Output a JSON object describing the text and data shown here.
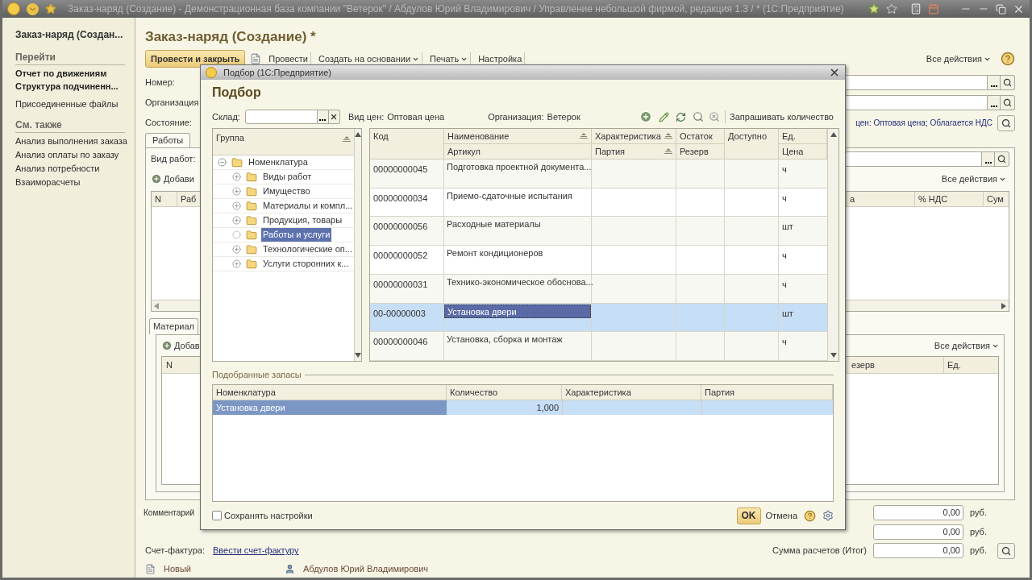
{
  "window": {
    "title": "Заказ-наряд (Создание) - Демонстрационная база компании \"Ветерок\" / Абдулов Юрий Владимирович / Управление небольшой фирмой, редакция 1.3 / * (1С:Предприятие)"
  },
  "sidebar": {
    "items": [
      {
        "kind": "title",
        "label": "Заказ-наряд (Создан..."
      },
      {
        "kind": "header",
        "label": "Перейти"
      },
      {
        "kind": "bold",
        "label": "Отчет по движениям"
      },
      {
        "kind": "bold",
        "label": "Структура подчиненн..."
      },
      {
        "kind": "link",
        "label": "Присоединенные файлы"
      },
      {
        "kind": "header",
        "label": "См. также"
      },
      {
        "kind": "link",
        "label": "Анализ выполнения заказа"
      },
      {
        "kind": "link",
        "label": "Анализ оплаты по заказу"
      },
      {
        "kind": "link",
        "label": "Анализ потребности"
      },
      {
        "kind": "link",
        "label": "Взаиморасчеты"
      }
    ]
  },
  "form": {
    "title": "Заказ-наряд (Создание) *",
    "toolbar": {
      "primary": "Провести и закрыть",
      "buttons": [
        {
          "label": "Провести",
          "dropdown": false
        },
        {
          "label": "Создать на основании",
          "dropdown": true
        },
        {
          "label": "Печать",
          "dropdown": true
        },
        {
          "label": "Настройка",
          "dropdown": false
        }
      ],
      "all_actions": "Все действия"
    },
    "fields": [
      {
        "label": "Номер:"
      },
      {
        "label": "Организация"
      },
      {
        "label": "Состояние:",
        "link": "цен: Оптовая цена; Облагается НДС"
      }
    ],
    "tabs": [
      {
        "label": "Работы",
        "selected": true
      }
    ],
    "works": {
      "label": "Вид работ:",
      "add": "Добави",
      "all_actions": "Все действия",
      "left_columns": [
        "N",
        "Раб"
      ],
      "right_columns": [
        "а",
        "% НДС",
        "Сум"
      ]
    },
    "materials": {
      "tabs": [
        {
          "label": "Материал",
          "selected": true
        }
      ],
      "add": "Добав",
      "all_actions": "Все действия",
      "left_columns": [
        "N"
      ],
      "right_columns": [
        "езерв",
        "Ед."
      ]
    },
    "comment_label": "Комментарий",
    "totals": [
      {
        "value": "0,00",
        "unit": "руб."
      },
      {
        "value": "0,00",
        "unit": "руб."
      },
      {
        "label": "Сумма расчетов (Итог)",
        "value": "0,00",
        "unit": "руб."
      }
    ],
    "invoice": {
      "label": "Счет-фактура:",
      "link": "Ввести счет-фактуру"
    },
    "status": {
      "state": "Новый",
      "user": "Абдулов Юрий Владимирович"
    }
  },
  "dialog": {
    "title": "Подбор (1С:Предприятие)",
    "heading": "Подбор",
    "warehouse_label": "Склад:",
    "price_label": "Вид цен:",
    "price_value": "Оптовая цена",
    "org_label": "Организация:",
    "org_value": "Ветерок",
    "ask_quantity": "Запрашивать количество",
    "tree": {
      "header": "Группа",
      "root": {
        "label": "Номенклатура",
        "expanded": true,
        "selected": false,
        "children": [
          {
            "label": "Виды работ",
            "kind": "group",
            "selected": false
          },
          {
            "label": "Имущество",
            "kind": "group",
            "selected": false
          },
          {
            "label": "Материалы и компл...",
            "kind": "group",
            "selected": false
          },
          {
            "label": "Продукция, товары",
            "kind": "group",
            "selected": false
          },
          {
            "label": "Работы и услуги",
            "kind": "leaf",
            "selected": true
          },
          {
            "label": "Технологические оп...",
            "kind": "group",
            "selected": false
          },
          {
            "label": "Услуги сторонних к...",
            "kind": "group",
            "selected": false
          }
        ]
      }
    },
    "table": {
      "columns": [
        {
          "top": "Код"
        },
        {
          "top": "Наименование",
          "bottom": "Артикул"
        },
        {
          "top": "Характеристика",
          "bottom": "Партия"
        },
        {
          "top": "Остаток",
          "bottom": "Резерв"
        },
        {
          "top": "Доступно"
        },
        {
          "top": "Ед.",
          "bottom": "Цена"
        }
      ],
      "rows": [
        {
          "code": "00000000045",
          "name": "Подготовка проектной документа...",
          "unit": "ч",
          "selected": false
        },
        {
          "code": "00000000034",
          "name": "Приемо-сдаточные испытания",
          "unit": "ч",
          "selected": false
        },
        {
          "code": "00000000056",
          "name": "Расходные материалы",
          "unit": "шт",
          "selected": false
        },
        {
          "code": "00000000052",
          "name": "Ремонт кондиционеров",
          "unit": "ч",
          "selected": false
        },
        {
          "code": "00000000031",
          "name": "Технико-экономическое обоснова...",
          "unit": "ч",
          "selected": false
        },
        {
          "code": "00-00000003",
          "name": "Установка двери",
          "unit": "шт",
          "selected": true
        },
        {
          "code": "00000000046",
          "name": "Установка, сборка и монтаж",
          "unit": "ч",
          "selected": false
        }
      ]
    },
    "picked": {
      "title": "Подобранные запасы",
      "columns": [
        "Номенклатура",
        "Количество",
        "Характеристика",
        "Партия"
      ],
      "rows": [
        {
          "name": "Установка двери",
          "quantity": "1,000",
          "selected": true
        }
      ]
    },
    "save_settings": {
      "label": "Сохранять настройки",
      "checked": false
    },
    "ok": "OK",
    "cancel": "Отмена"
  }
}
